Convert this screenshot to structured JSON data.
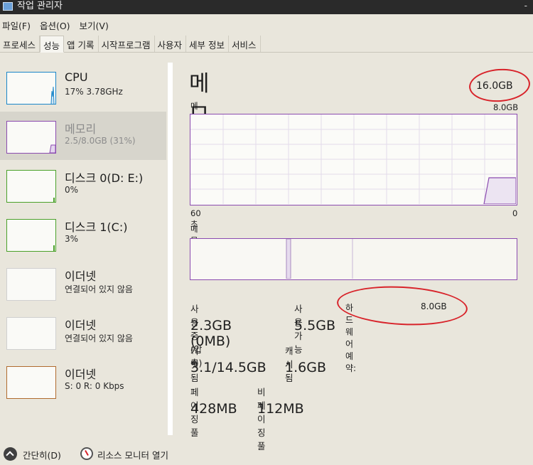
{
  "window": {
    "title": "작업 관리자",
    "minimize_glyph": "-"
  },
  "menu": [
    "파일(F)",
    "옵션(O)",
    "보기(V)"
  ],
  "tabs": [
    {
      "label": "프로세스",
      "active": false
    },
    {
      "label": "성능",
      "active": true
    },
    {
      "label": "앱 기록",
      "active": false
    },
    {
      "label": "시작프로그램",
      "active": false
    },
    {
      "label": "사용자",
      "active": false
    },
    {
      "label": "세부 정보",
      "active": false
    },
    {
      "label": "서비스",
      "active": false
    }
  ],
  "sidebar": {
    "items": [
      {
        "name": "CPU",
        "sub": "17% 3.78GHz",
        "color": "#1a86c9",
        "selected": false
      },
      {
        "name": "메모리",
        "sub": "2.5/8.0GB (31%)",
        "color": "#8b4bb0",
        "selected": true
      },
      {
        "name": "디스크 0(D: E:)",
        "sub": "0%",
        "color": "#4aa12a",
        "selected": false
      },
      {
        "name": "디스크 1(C:)",
        "sub": "3%",
        "color": "#4aa12a",
        "selected": false
      },
      {
        "name": "이더넷",
        "sub": "연결되어 있지 않음",
        "color": "#d0d0d0",
        "selected": false
      },
      {
        "name": "이더넷",
        "sub": "연결되어 있지 않음",
        "color": "#d0d0d0",
        "selected": false
      },
      {
        "name": "이더넷",
        "sub": "S: 0 R: 0 Kbps",
        "color": "#b06b2e",
        "selected": false
      }
    ]
  },
  "memory": {
    "title": "메모리",
    "total": "16.0GB",
    "usage_label": "메모리 사용",
    "usage_max": "8.0GB",
    "axis_left": "60초",
    "axis_right": "0",
    "composition_label": "메모리 구성",
    "accent": "#8b4bb0",
    "stats": {
      "in_use_label": "사용 중(압축)",
      "in_use_value": "2.3GB (0MB)",
      "available_label": "사용 가능",
      "available_value": "5.5GB",
      "hw_reserved_label": "하드웨어 예약:",
      "hw_reserved_value": "8.0GB",
      "committed_label": "커밋됨",
      "committed_value": "3.1/14.5GB",
      "cached_label": "캐시됨",
      "cached_value": "1.6GB",
      "paged_label": "페이징 풀",
      "paged_value": "428MB",
      "nonpaged_label": "비페이징 풀",
      "nonpaged_value": "112MB"
    }
  },
  "footer": {
    "collapse_label": "간단히(D)",
    "monitor_label": "리소스 모니터 열기"
  }
}
